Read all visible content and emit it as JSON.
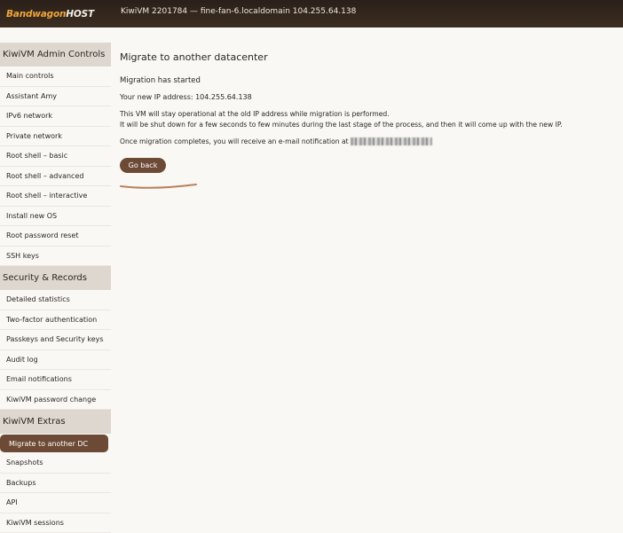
{
  "header": {
    "logo_part1": "Bandwagon",
    "logo_part2": "HOST",
    "vm_info": "KiwiVM 2201784 — fine-fan-6.localdomain  104.255.64.138"
  },
  "sidebar": {
    "sections": [
      {
        "title": "KiwiVM Admin Controls",
        "items": [
          "Main controls",
          "Assistant Amy",
          "IPv6 network",
          "Private network",
          "Root shell – basic",
          "Root shell – advanced",
          "Root shell – interactive",
          "Install new OS",
          "Root password reset",
          "SSH keys"
        ]
      },
      {
        "title": "Security & Records",
        "items": [
          "Detailed statistics",
          "Two-factor authentication",
          "Passkeys and Security keys",
          "Audit log",
          "Email notifications",
          "KiwiVM password change"
        ]
      },
      {
        "title": "KiwiVM Extras",
        "items": [
          "Migrate to another DC",
          "Snapshots",
          "Backups",
          "API",
          "KiwiVM sessions"
        ]
      }
    ],
    "active_item": "Migrate to another DC"
  },
  "main": {
    "title": "Migrate to another datacenter",
    "status": "Migration has started",
    "new_ip": "Your new IP address: 104.255.64.138",
    "para_line1": "This VM will stay operational at the old IP address while migration is performed.",
    "para_line2": "It will be shut down for a few seconds to few minutes during the last stage of the process, and then it will come up with the new IP.",
    "notification": "Once migration completes, you will receive an e-mail notification at",
    "go_back_label": "Go back"
  },
  "colors": {
    "accent": "#6d4a35",
    "header_bg": "#2a2019",
    "section_bg": "#ddd7cf",
    "logo_orange": "#f0a53a"
  }
}
